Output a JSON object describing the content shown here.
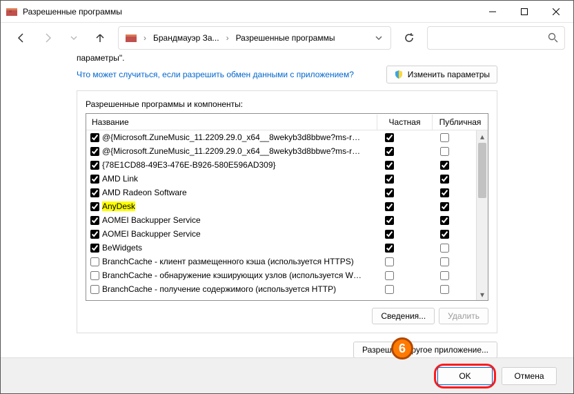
{
  "title": "Разрешенные программы",
  "breadcrumbs": {
    "seg1": "Брандмауэр За...",
    "seg2": "Разрешенные программы"
  },
  "content": {
    "param_line": "параметры\".",
    "link": "Что может случиться, если разрешить обмен данными с приложением?",
    "change_btn": "Изменить параметры",
    "panel_label": "Разрешенные программы и компоненты:",
    "cols": {
      "name": "Название",
      "priv": "Частная",
      "pub": "Публичная"
    },
    "items": [
      {
        "on": true,
        "name": "@{Microsoft.ZuneMusic_11.2209.29.0_x64__8wekyb3d8bbwe?ms-reso...",
        "priv": true,
        "pub": false,
        "hl": false
      },
      {
        "on": true,
        "name": "@{Microsoft.ZuneMusic_11.2209.29.0_x64__8wekyb3d8bbwe?ms-reso...",
        "priv": true,
        "pub": false,
        "hl": false
      },
      {
        "on": true,
        "name": "{78E1CD88-49E3-476E-B926-580E596AD309}",
        "priv": true,
        "pub": true,
        "hl": false
      },
      {
        "on": true,
        "name": "AMD Link",
        "priv": true,
        "pub": true,
        "hl": false
      },
      {
        "on": true,
        "name": "AMD Radeon Software",
        "priv": true,
        "pub": true,
        "hl": false
      },
      {
        "on": true,
        "name": "AnyDesk",
        "priv": true,
        "pub": true,
        "hl": true
      },
      {
        "on": true,
        "name": "AOMEI Backupper Service",
        "priv": true,
        "pub": true,
        "hl": false
      },
      {
        "on": true,
        "name": "AOMEI Backupper Service",
        "priv": true,
        "pub": true,
        "hl": false
      },
      {
        "on": true,
        "name": "BeWidgets",
        "priv": true,
        "pub": false,
        "hl": false
      },
      {
        "on": false,
        "name": "BranchCache - клиент размещенного кэша (используется HTTPS)",
        "priv": false,
        "pub": false,
        "hl": false
      },
      {
        "on": false,
        "name": "BranchCache - обнаружение кэширующих узлов (используется WSD)",
        "priv": false,
        "pub": false,
        "hl": false
      },
      {
        "on": false,
        "name": "BranchCache - получение содержимого (используется HTTP)",
        "priv": false,
        "pub": false,
        "hl": false
      }
    ],
    "details_btn": "Сведения...",
    "remove_btn": "Удалить",
    "allow_other": "Разрешить другое приложение..."
  },
  "footer": {
    "ok": "OK",
    "cancel": "Отмена"
  },
  "step": "6"
}
